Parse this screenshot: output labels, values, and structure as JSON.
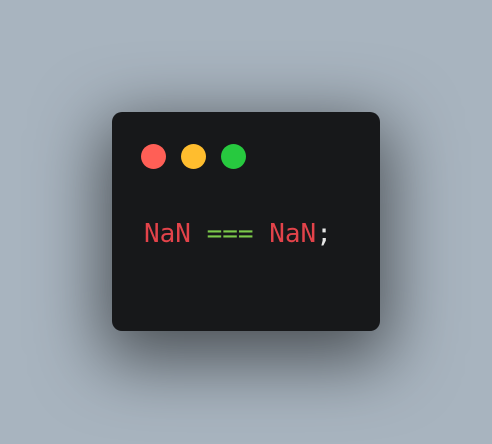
{
  "window": {
    "controls": [
      {
        "name": "close",
        "color": "#ff5f56"
      },
      {
        "name": "minimize",
        "color": "#ffbd2e"
      },
      {
        "name": "zoom",
        "color": "#27c93f"
      }
    ]
  },
  "code": {
    "tokens": [
      {
        "text": "NaN",
        "color": "#e3434a"
      },
      {
        "text": " ",
        "color": "#e6e6e6"
      },
      {
        "text": "===",
        "color": "#7bc94a"
      },
      {
        "text": " ",
        "color": "#e6e6e6"
      },
      {
        "text": "NaN",
        "color": "#e3434a"
      },
      {
        "text": ";",
        "color": "#e6e6e6"
      }
    ]
  }
}
